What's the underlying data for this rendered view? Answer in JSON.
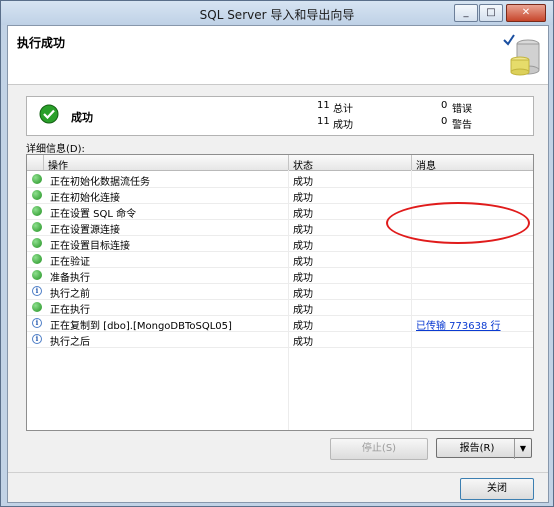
{
  "window": {
    "title": "SQL Server 导入和导出向导"
  },
  "header": {
    "title": "执行成功"
  },
  "summary": {
    "status_label": "成功",
    "total_count": "11",
    "total_label": "总计",
    "success_count": "11",
    "success_label": "成功",
    "error_count": "0",
    "error_label": "错误",
    "warning_count": "0",
    "warning_label": "警告"
  },
  "details": {
    "label": "详细信息(D):",
    "columns": [
      "操作",
      "状态",
      "消息"
    ],
    "rows": [
      {
        "icon": "success-icon",
        "action": "正在初始化数据流任务",
        "status": "成功",
        "message": ""
      },
      {
        "icon": "success-icon",
        "action": "正在初始化连接",
        "status": "成功",
        "message": ""
      },
      {
        "icon": "success-icon",
        "action": "正在设置 SQL 命令",
        "status": "成功",
        "message": ""
      },
      {
        "icon": "success-icon",
        "action": "正在设置源连接",
        "status": "成功",
        "message": ""
      },
      {
        "icon": "success-icon",
        "action": "正在设置目标连接",
        "status": "成功",
        "message": ""
      },
      {
        "icon": "success-icon",
        "action": "正在验证",
        "status": "成功",
        "message": ""
      },
      {
        "icon": "success-icon",
        "action": "准备执行",
        "status": "成功",
        "message": ""
      },
      {
        "icon": "info-icon",
        "action": "执行之前",
        "status": "成功",
        "message": ""
      },
      {
        "icon": "success-icon",
        "action": "正在执行",
        "status": "成功",
        "message": ""
      },
      {
        "icon": "info-icon",
        "action": "正在复制到 [dbo].[MongoDBToSQL05]",
        "status": "成功",
        "message": "已传输 773638 行"
      },
      {
        "icon": "info-icon",
        "action": "执行之后",
        "status": "成功",
        "message": ""
      }
    ]
  },
  "buttons": {
    "stop": "停止(S)",
    "report": "报告(R)",
    "close": "关闭"
  },
  "colors": {
    "annotation": "#e01b1b",
    "link": "#0b3bd1"
  }
}
